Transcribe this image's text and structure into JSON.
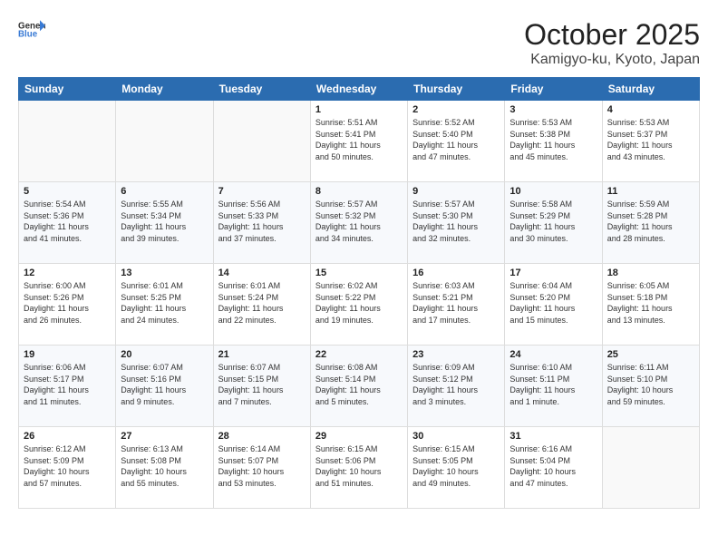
{
  "header": {
    "logo_general": "General",
    "logo_blue": "Blue",
    "month": "October 2025",
    "location": "Kamigyo-ku, Kyoto, Japan"
  },
  "weekdays": [
    "Sunday",
    "Monday",
    "Tuesday",
    "Wednesday",
    "Thursday",
    "Friday",
    "Saturday"
  ],
  "weeks": [
    [
      {
        "day": "",
        "info": ""
      },
      {
        "day": "",
        "info": ""
      },
      {
        "day": "",
        "info": ""
      },
      {
        "day": "1",
        "info": "Sunrise: 5:51 AM\nSunset: 5:41 PM\nDaylight: 11 hours\nand 50 minutes."
      },
      {
        "day": "2",
        "info": "Sunrise: 5:52 AM\nSunset: 5:40 PM\nDaylight: 11 hours\nand 47 minutes."
      },
      {
        "day": "3",
        "info": "Sunrise: 5:53 AM\nSunset: 5:38 PM\nDaylight: 11 hours\nand 45 minutes."
      },
      {
        "day": "4",
        "info": "Sunrise: 5:53 AM\nSunset: 5:37 PM\nDaylight: 11 hours\nand 43 minutes."
      }
    ],
    [
      {
        "day": "5",
        "info": "Sunrise: 5:54 AM\nSunset: 5:36 PM\nDaylight: 11 hours\nand 41 minutes."
      },
      {
        "day": "6",
        "info": "Sunrise: 5:55 AM\nSunset: 5:34 PM\nDaylight: 11 hours\nand 39 minutes."
      },
      {
        "day": "7",
        "info": "Sunrise: 5:56 AM\nSunset: 5:33 PM\nDaylight: 11 hours\nand 37 minutes."
      },
      {
        "day": "8",
        "info": "Sunrise: 5:57 AM\nSunset: 5:32 PM\nDaylight: 11 hours\nand 34 minutes."
      },
      {
        "day": "9",
        "info": "Sunrise: 5:57 AM\nSunset: 5:30 PM\nDaylight: 11 hours\nand 32 minutes."
      },
      {
        "day": "10",
        "info": "Sunrise: 5:58 AM\nSunset: 5:29 PM\nDaylight: 11 hours\nand 30 minutes."
      },
      {
        "day": "11",
        "info": "Sunrise: 5:59 AM\nSunset: 5:28 PM\nDaylight: 11 hours\nand 28 minutes."
      }
    ],
    [
      {
        "day": "12",
        "info": "Sunrise: 6:00 AM\nSunset: 5:26 PM\nDaylight: 11 hours\nand 26 minutes."
      },
      {
        "day": "13",
        "info": "Sunrise: 6:01 AM\nSunset: 5:25 PM\nDaylight: 11 hours\nand 24 minutes."
      },
      {
        "day": "14",
        "info": "Sunrise: 6:01 AM\nSunset: 5:24 PM\nDaylight: 11 hours\nand 22 minutes."
      },
      {
        "day": "15",
        "info": "Sunrise: 6:02 AM\nSunset: 5:22 PM\nDaylight: 11 hours\nand 19 minutes."
      },
      {
        "day": "16",
        "info": "Sunrise: 6:03 AM\nSunset: 5:21 PM\nDaylight: 11 hours\nand 17 minutes."
      },
      {
        "day": "17",
        "info": "Sunrise: 6:04 AM\nSunset: 5:20 PM\nDaylight: 11 hours\nand 15 minutes."
      },
      {
        "day": "18",
        "info": "Sunrise: 6:05 AM\nSunset: 5:18 PM\nDaylight: 11 hours\nand 13 minutes."
      }
    ],
    [
      {
        "day": "19",
        "info": "Sunrise: 6:06 AM\nSunset: 5:17 PM\nDaylight: 11 hours\nand 11 minutes."
      },
      {
        "day": "20",
        "info": "Sunrise: 6:07 AM\nSunset: 5:16 PM\nDaylight: 11 hours\nand 9 minutes."
      },
      {
        "day": "21",
        "info": "Sunrise: 6:07 AM\nSunset: 5:15 PM\nDaylight: 11 hours\nand 7 minutes."
      },
      {
        "day": "22",
        "info": "Sunrise: 6:08 AM\nSunset: 5:14 PM\nDaylight: 11 hours\nand 5 minutes."
      },
      {
        "day": "23",
        "info": "Sunrise: 6:09 AM\nSunset: 5:12 PM\nDaylight: 11 hours\nand 3 minutes."
      },
      {
        "day": "24",
        "info": "Sunrise: 6:10 AM\nSunset: 5:11 PM\nDaylight: 11 hours\nand 1 minute."
      },
      {
        "day": "25",
        "info": "Sunrise: 6:11 AM\nSunset: 5:10 PM\nDaylight: 10 hours\nand 59 minutes."
      }
    ],
    [
      {
        "day": "26",
        "info": "Sunrise: 6:12 AM\nSunset: 5:09 PM\nDaylight: 10 hours\nand 57 minutes."
      },
      {
        "day": "27",
        "info": "Sunrise: 6:13 AM\nSunset: 5:08 PM\nDaylight: 10 hours\nand 55 minutes."
      },
      {
        "day": "28",
        "info": "Sunrise: 6:14 AM\nSunset: 5:07 PM\nDaylight: 10 hours\nand 53 minutes."
      },
      {
        "day": "29",
        "info": "Sunrise: 6:15 AM\nSunset: 5:06 PM\nDaylight: 10 hours\nand 51 minutes."
      },
      {
        "day": "30",
        "info": "Sunrise: 6:15 AM\nSunset: 5:05 PM\nDaylight: 10 hours\nand 49 minutes."
      },
      {
        "day": "31",
        "info": "Sunrise: 6:16 AM\nSunset: 5:04 PM\nDaylight: 10 hours\nand 47 minutes."
      },
      {
        "day": "",
        "info": ""
      }
    ]
  ]
}
